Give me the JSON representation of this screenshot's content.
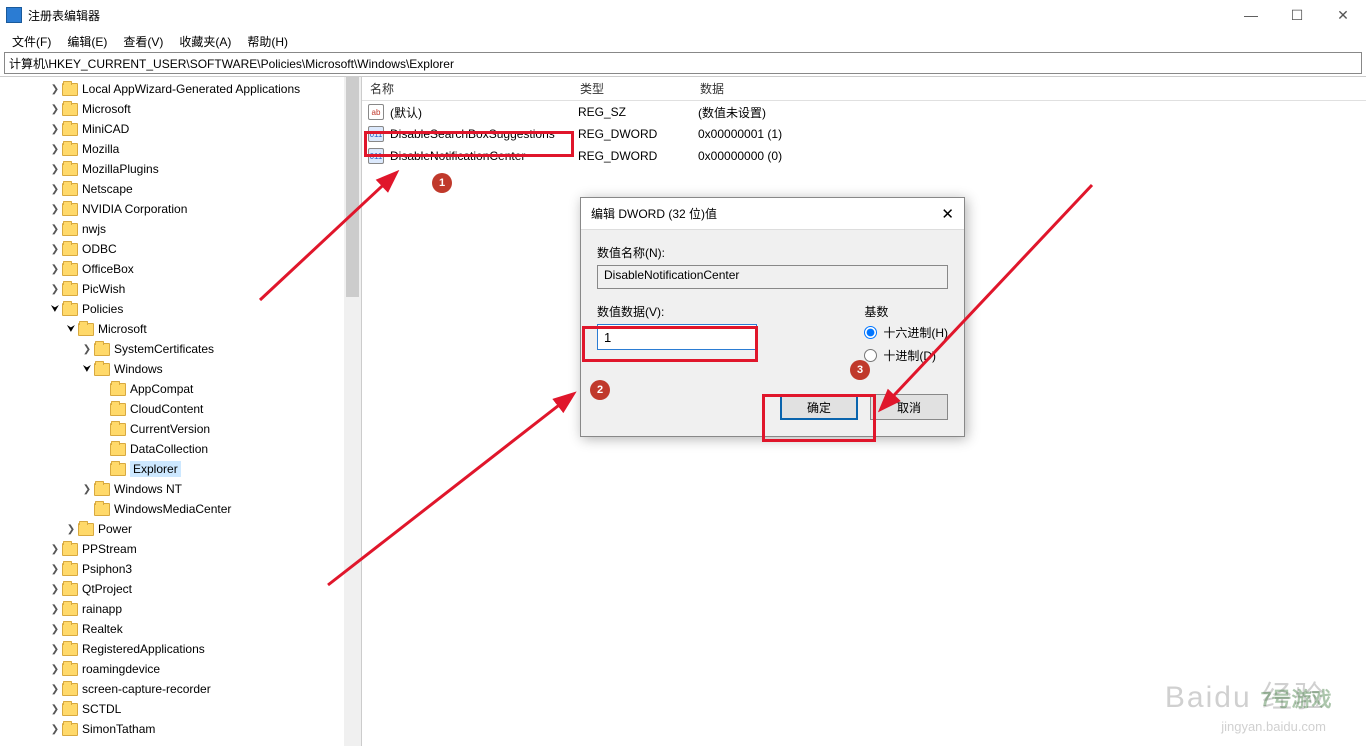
{
  "window": {
    "title": "注册表编辑器",
    "minimize": "—",
    "maximize": "☐",
    "close": "✕"
  },
  "menu": {
    "file": "文件(F)",
    "edit": "编辑(E)",
    "view": "查看(V)",
    "favorites": "收藏夹(A)",
    "help": "帮助(H)"
  },
  "address": "计算机\\HKEY_CURRENT_USER\\SOFTWARE\\Policies\\Microsoft\\Windows\\Explorer",
  "tree": [
    {
      "label": "Local AppWizard-Generated Applications",
      "depth": 1,
      "expanded": false,
      "hasArrow": true
    },
    {
      "label": "Microsoft",
      "depth": 1,
      "expanded": false,
      "hasArrow": true
    },
    {
      "label": "MiniCAD",
      "depth": 1,
      "expanded": false,
      "hasArrow": true
    },
    {
      "label": "Mozilla",
      "depth": 1,
      "expanded": false,
      "hasArrow": true
    },
    {
      "label": "MozillaPlugins",
      "depth": 1,
      "expanded": false,
      "hasArrow": true
    },
    {
      "label": "Netscape",
      "depth": 1,
      "expanded": false,
      "hasArrow": true
    },
    {
      "label": "NVIDIA Corporation",
      "depth": 1,
      "expanded": false,
      "hasArrow": true
    },
    {
      "label": "nwjs",
      "depth": 1,
      "expanded": false,
      "hasArrow": true
    },
    {
      "label": "ODBC",
      "depth": 1,
      "expanded": false,
      "hasArrow": true
    },
    {
      "label": "OfficeBox",
      "depth": 1,
      "expanded": false,
      "hasArrow": true
    },
    {
      "label": "PicWish",
      "depth": 1,
      "expanded": false,
      "hasArrow": true
    },
    {
      "label": "Policies",
      "depth": 1,
      "expanded": true,
      "hasArrow": true
    },
    {
      "label": "Microsoft",
      "depth": 2,
      "expanded": true,
      "hasArrow": true
    },
    {
      "label": "SystemCertificates",
      "depth": 3,
      "expanded": false,
      "hasArrow": true
    },
    {
      "label": "Windows",
      "depth": 3,
      "expanded": true,
      "hasArrow": true
    },
    {
      "label": "AppCompat",
      "depth": 4,
      "expanded": false,
      "hasArrow": false
    },
    {
      "label": "CloudContent",
      "depth": 4,
      "expanded": false,
      "hasArrow": false
    },
    {
      "label": "CurrentVersion",
      "depth": 4,
      "expanded": false,
      "hasArrow": false
    },
    {
      "label": "DataCollection",
      "depth": 4,
      "expanded": false,
      "hasArrow": false
    },
    {
      "label": "Explorer",
      "depth": 4,
      "expanded": false,
      "hasArrow": false,
      "selected": true
    },
    {
      "label": "Windows NT",
      "depth": 3,
      "expanded": false,
      "hasArrow": true
    },
    {
      "label": "WindowsMediaCenter",
      "depth": 3,
      "expanded": false,
      "hasArrow": false
    },
    {
      "label": "Power",
      "depth": 2,
      "expanded": false,
      "hasArrow": true
    },
    {
      "label": "PPStream",
      "depth": 1,
      "expanded": false,
      "hasArrow": true
    },
    {
      "label": "Psiphon3",
      "depth": 1,
      "expanded": false,
      "hasArrow": true
    },
    {
      "label": "QtProject",
      "depth": 1,
      "expanded": false,
      "hasArrow": true
    },
    {
      "label": "rainapp",
      "depth": 1,
      "expanded": false,
      "hasArrow": true
    },
    {
      "label": "Realtek",
      "depth": 1,
      "expanded": false,
      "hasArrow": true
    },
    {
      "label": "RegisteredApplications",
      "depth": 1,
      "expanded": false,
      "hasArrow": true
    },
    {
      "label": "roamingdevice",
      "depth": 1,
      "expanded": false,
      "hasArrow": true
    },
    {
      "label": "screen-capture-recorder",
      "depth": 1,
      "expanded": false,
      "hasArrow": true
    },
    {
      "label": "SCTDL",
      "depth": 1,
      "expanded": false,
      "hasArrow": true
    },
    {
      "label": "SimonTatham",
      "depth": 1,
      "expanded": false,
      "hasArrow": true
    }
  ],
  "list": {
    "headers": {
      "name": "名称",
      "type": "类型",
      "data": "数据"
    },
    "rows": [
      {
        "icon": "str",
        "iconText": "ab",
        "name": "(默认)",
        "type": "REG_SZ",
        "data": "(数值未设置)"
      },
      {
        "icon": "dword",
        "iconText": "011",
        "name": "DisableSearchBoxSuggestions",
        "type": "REG_DWORD",
        "data": "0x00000001 (1)"
      },
      {
        "icon": "dword",
        "iconText": "011",
        "name": "DisableNotificationCenter",
        "type": "REG_DWORD",
        "data": "0x00000000 (0)"
      }
    ]
  },
  "dialog": {
    "title": "编辑 DWORD (32 位)值",
    "nameLabel": "数值名称(N):",
    "nameValue": "DisableNotificationCenter",
    "dataLabel": "数值数据(V):",
    "dataValue": "1",
    "baseLabel": "基数",
    "hexLabel": "十六进制(H)",
    "decLabel": "十进制(D)",
    "ok": "确定",
    "cancel": "取消"
  },
  "annotations": {
    "badge1": "1",
    "badge2": "2",
    "badge3": "3"
  },
  "watermark": {
    "main": "Baidu 经验",
    "sub": "jingyan.baidu.com",
    "logo": "7号游戏"
  }
}
